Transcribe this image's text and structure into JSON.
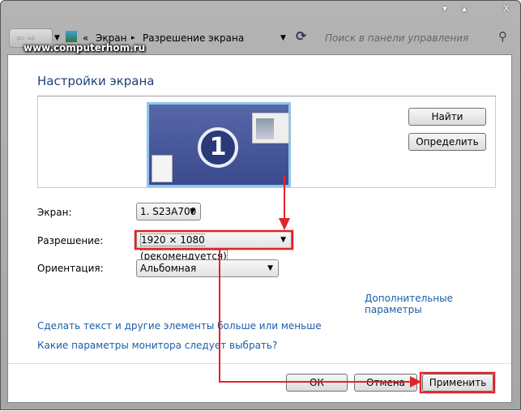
{
  "window": {
    "minimize": "▾",
    "maximize": "▴",
    "close": "X"
  },
  "nav": {
    "back": "⇦",
    "forward": "⇨",
    "crumb_prefix": "«",
    "crumb_1": "Экран",
    "crumb_sep": "▸",
    "crumb_2": "Разрешение экрана",
    "refresh": "⟳",
    "search_placeholder": "Поиск в панели управления",
    "search_icon": "⚲"
  },
  "watermark": "www.computerhom.ru",
  "page": {
    "title": "Настройки экрана",
    "monitor_number": "1",
    "find_button": "Найти",
    "identify_button": "Определить"
  },
  "fields": {
    "screen_label": "Экран:",
    "screen_value": "1. S23A700",
    "resolution_label": "Разрешение:",
    "resolution_value": "1920 × 1080 (рекомендуется)",
    "orientation_label": "Ориентация:",
    "orientation_value": "Альбомная"
  },
  "links": {
    "advanced": "Дополнительные параметры",
    "text_size": "Сделать текст и другие элементы больше или меньше",
    "which_settings": "Какие параметры монитора следует выбрать?"
  },
  "buttons": {
    "ok": "ОК",
    "cancel": "Отмена",
    "apply": "Применить"
  },
  "annotation_color": "#e3222a"
}
